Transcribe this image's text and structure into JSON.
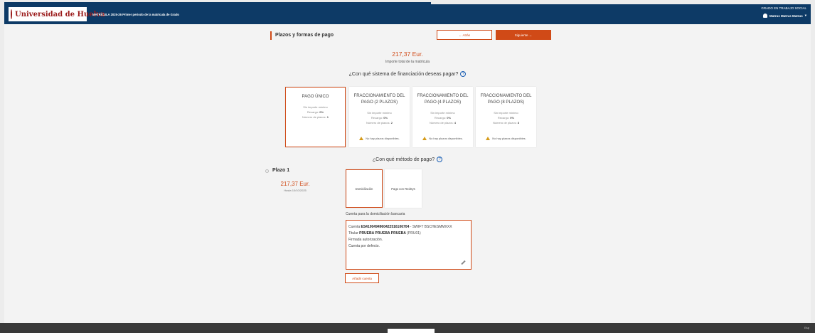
{
  "header": {
    "logo_text": "Universidad de Huelva",
    "title": "MATRÍCULA 2025-26 Primer periodo de la matrícula de Grado",
    "degree": "GRADO EN TRABAJO SOCIAL",
    "user": "Matrus Matrus Matrus"
  },
  "nav": {
    "section_title": "Plazos y formas de pago",
    "back_label": "← Atrás",
    "next_label": "Siguiente →"
  },
  "total": {
    "amount": "217,37 Eur.",
    "label": "Importe total de la matrícula"
  },
  "financing": {
    "question": "¿Con qué sistema de financiación deseas pagar?",
    "options": [
      {
        "title": "PAGO ÚNICO",
        "min": "Sin importe mínimo",
        "surcharge_label": "Recargo:",
        "surcharge": "0%",
        "plazos_label": "Número de plazos:",
        "plazos": "1",
        "warning": ""
      },
      {
        "title": "FRACCIONAMIENTO DEL PAGO (2 PLAZOS)",
        "min": "Sin importe mínimo",
        "surcharge_label": "Recargo:",
        "surcharge": "0%",
        "plazos_label": "Número de plazos:",
        "plazos": "2",
        "warning": "No hay plazos disponibles."
      },
      {
        "title": "FRACCIONAMIENTO DEL PAGO (4 PLAZOS)",
        "min": "Sin importe mínimo",
        "surcharge_label": "Recargo:",
        "surcharge": "0%",
        "plazos_label": "Número de plazos:",
        "plazos": "4",
        "warning": "No hay plazos disponibles."
      },
      {
        "title": "FRACCIONAMIENTO DEL PAGO (8 PLAZOS)",
        "min": "Sin importe mínimo",
        "surcharge_label": "Recargo:",
        "surcharge": "0%",
        "plazos_label": "Número de plazos:",
        "plazos": "8",
        "warning": "No hay plazos disponibles."
      }
    ],
    "selected_index": 0
  },
  "method": {
    "question": "¿Con qué método de pago?",
    "options": [
      "Domiciliación",
      "Pago con RedSys"
    ],
    "selected_index": 0
  },
  "plazo": {
    "title": "Plazo 1",
    "amount": "217,37 Eur.",
    "date": "Hasta 10/10/2025"
  },
  "account": {
    "label": "Cuenta para la domiciliación bancaria",
    "cuenta_label": "Cuenta",
    "iban": "ES4100494960422516106704",
    "swift": "- SWIFT BSCHESMMXXX",
    "titular_label": "Titular",
    "titular": "PRUEBA PRUEBA PRUEBA",
    "titular_code": "(PRU01)",
    "auth": "Firmada autorización.",
    "default": "Cuenta por defecto.",
    "add_label": "Añadir cuenta"
  },
  "footer": {
    "lang": "Esp"
  },
  "colors": {
    "accent": "#d04a17",
    "header": "#0d3a66",
    "footer": "#3a3a3a"
  }
}
